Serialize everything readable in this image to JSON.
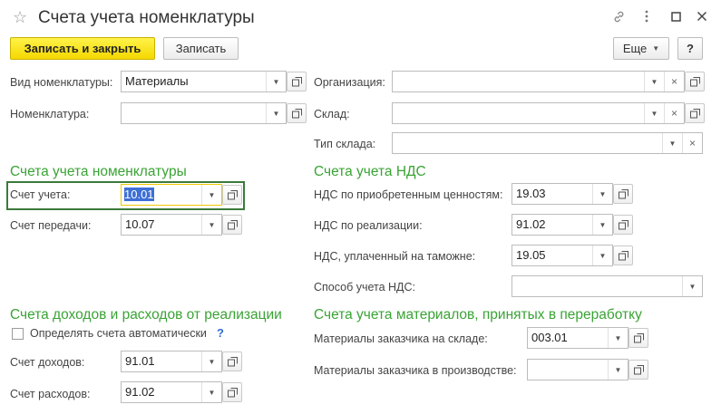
{
  "window": {
    "title": "Счета учета номенклатуры"
  },
  "toolbar": {
    "save_close_label": "Записать и закрыть",
    "save_label": "Записать",
    "more_label": "Еще",
    "help_label": "?"
  },
  "general": {
    "kind_label": "Вид номенклатуры:",
    "kind_value": "Материалы",
    "item_label": "Номенклатура:",
    "item_value": "",
    "org_label": "Организация:",
    "org_value": "",
    "warehouse_label": "Склад:",
    "warehouse_value": "",
    "warehouse_type_label": "Тип склада:",
    "warehouse_type_value": ""
  },
  "item_accounts": {
    "title": "Счета учета номенклатуры",
    "account_label": "Счет учета:",
    "account_value": "10.01",
    "transfer_label": "Счет передачи:",
    "transfer_value": "10.07"
  },
  "vat_accounts": {
    "title": "Счета учета НДС",
    "purchased_label": "НДС по приобретенным ценностям:",
    "purchased_value": "19.03",
    "sales_label": "НДС по реализации:",
    "sales_value": "91.02",
    "customs_label": "НДС, уплаченный на таможне:",
    "customs_value": "19.05",
    "method_label": "Способ учета НДС:",
    "method_value": ""
  },
  "income_accounts": {
    "title": "Счета доходов и расходов от реализации",
    "auto_label": "Определять счета автоматически",
    "auto_help": "?",
    "income_label": "Счет доходов:",
    "income_value": "91.01",
    "expense_label": "Счет расходов:",
    "expense_value": "91.02"
  },
  "processing_accounts": {
    "title": "Счета учета материалов, принятых в переработку",
    "warehouse_label": "Материалы заказчика на складе:",
    "warehouse_value": "003.01",
    "production_label": "Материалы заказчика в производстве:",
    "production_value": ""
  },
  "colors": {
    "section_title": "#3aa335",
    "primary_button": "#f5d800",
    "focus_frame": "#3b7a3b",
    "selection": "#3d6fd6"
  }
}
